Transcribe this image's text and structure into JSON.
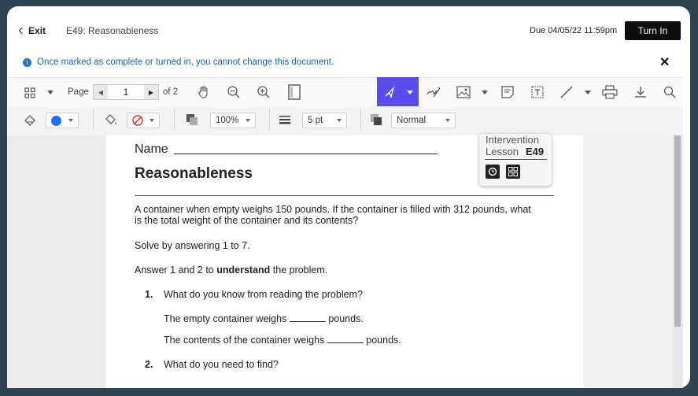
{
  "header": {
    "exit_label": "Exit",
    "doc_title": "E49: Reasonableness",
    "due": "Due 04/05/22 11:59pm",
    "turn_in_label": "Turn In"
  },
  "notice": {
    "text": "Once marked as complete or turned in, you cannot change this document."
  },
  "toolbar": {
    "page_label": "Page",
    "page_value": "1",
    "of_label": "of 2",
    "icons": [
      "grid-icon",
      "chevron-down-icon",
      "hand-icon",
      "zoom-out-icon",
      "zoom-in-icon",
      "single-page-icon",
      "select-pointer-icon",
      "signature-icon",
      "image-icon",
      "note-icon",
      "text-box-icon",
      "line-icon",
      "print-icon",
      "download-icon",
      "search-icon"
    ]
  },
  "format_bar": {
    "stroke_color": "#1a73e8",
    "opacity_value": "100%",
    "width_value": "5 pt",
    "blend_value": "Normal"
  },
  "document": {
    "name_label": "Name",
    "title": "Reasonableness",
    "problem": "A container when empty weighs 150 pounds. If the container is filled with 312 pounds, what is the total weight of the container and its contents?",
    "solve": "Solve by answering 1 to 7.",
    "answer_pre": "Answer 1 and 2 to ",
    "answer_bold": "understand",
    "answer_post": " the problem.",
    "q1_num": "1.",
    "q1": "What do you know from reading the problem?",
    "q1a_pre": "The empty container weighs",
    "q1a_post": "pounds.",
    "q1b_pre": "The contents of the container weighs",
    "q1b_post": "pounds.",
    "q2_num": "2.",
    "q2": "What do you need to find?",
    "card_line1": "Intervention",
    "card_line2": "Lesson",
    "card_lesson": "E49"
  }
}
